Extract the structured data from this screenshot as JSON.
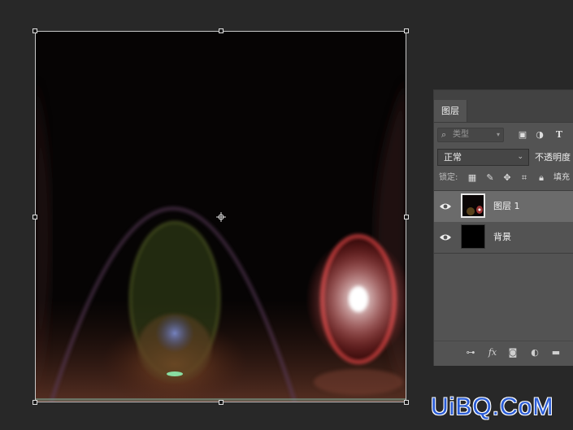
{
  "panel": {
    "tab_label": "图层",
    "filter": {
      "placeholder": "类型",
      "icons": [
        "image-filter-icon",
        "adjustment-filter-icon",
        "type-filter-icon"
      ]
    },
    "blend_mode": "正常",
    "opacity_label": "不透明度",
    "lock_label": "锁定:",
    "lock_icons": [
      "lock-transparent-icon",
      "lock-paint-icon",
      "lock-move-icon",
      "lock-artboard-icon",
      "lock-all-icon"
    ],
    "fill_label": "填充",
    "layers": [
      {
        "name": "图层 1",
        "visible": true,
        "selected": true
      },
      {
        "name": "背景",
        "visible": true,
        "selected": false
      }
    ],
    "footer_icons": [
      "link-layers-icon",
      "fx-icon",
      "add-mask-icon",
      "adjustment-layer-icon",
      "new-group-icon"
    ]
  },
  "watermark": "UiBQ.CoM",
  "colors": {
    "app_bg": "#282828",
    "panel_bg": "#535353",
    "selected_layer": "#6b6b6b",
    "watermark": "#2a5cd6"
  }
}
